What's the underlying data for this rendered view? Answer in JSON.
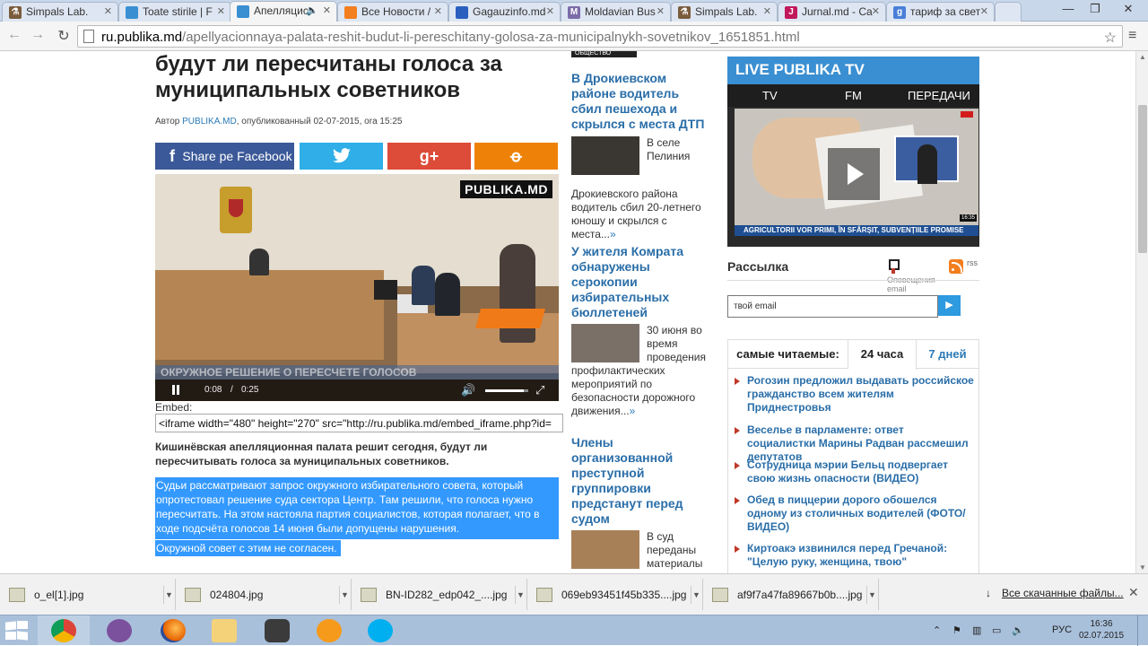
{
  "browser": {
    "tabs": [
      {
        "label": "Simpals Lab.",
        "icon": "flask-icon",
        "color": "#7a5c3c"
      },
      {
        "label": "Toate stirile | F",
        "icon": "page-icon",
        "color": "#3a8fd2"
      },
      {
        "label": "Апелляцис",
        "icon": "page-icon",
        "color": "#3a8fd2"
      },
      {
        "label": "Все Новости /",
        "icon": "rss-icon",
        "color": "#f27e1f"
      },
      {
        "label": "Gagauzinfo.md",
        "icon": "flag-icon",
        "color": "#2b5fbe"
      },
      {
        "label": "Moldavian Bus",
        "icon": "m-icon",
        "color": "#7b6ca8"
      },
      {
        "label": "Simpals Lab.",
        "icon": "flask-icon",
        "color": "#7a5c3c"
      },
      {
        "label": "Jurnal.md - Ca",
        "icon": "j-icon",
        "color": "#c2185b"
      },
      {
        "label": "тариф за свет",
        "icon": "google-icon",
        "color": "#4a7fd8"
      }
    ],
    "url_domain": "ru.publika.md",
    "url_path": "/apellyacionnaya-palata-reshit-budut-li-pereschitany-golosa-za-municipalnykh-sovetnikov_1651851.html"
  },
  "article": {
    "headline": "будут ли пересчитаны голоса за муниципальных советников",
    "byline_prefix": "Автор",
    "byline_author": "PUBLIKA.MD",
    "byline_suffix": ", опубликованный 02-07-2015, ora 15:25",
    "share": {
      "facebook": "Share pe Facebook",
      "twitter": "twitter",
      "google": "g+",
      "ok": "ok"
    },
    "video": {
      "logo": "PUBLIKA.MD",
      "lower_third": "ОКРУЖНОЕ РЕШЕНИЕ О ПЕРЕСЧЕТЕ ГОЛОСОВ",
      "time_current": "0:08",
      "time_sep": "/",
      "time_total": "0:25",
      "volume": 0.9
    },
    "embed_label": "Embed:",
    "embed_code": "<iframe width=\"480\" height=\"270\" src=\"http://ru.publika.md/embed_iframe.php?id=",
    "lead": "Кишинёвская апелляционная палата решит сегодня, будут ли пересчитывать голоса за муниципальных советников.",
    "p1": "Судьи рассматривают запрос окружного избирательного совета, который опротестовал решение суда сектора Центр. Там решили, что голоса нужно пересчитать. На этом настояла партия социалистов, которая полагает, что в ходе подсчёта голосов 14 июня были допущены нарушения.",
    "p2": "Окружной совет с этим не согласен."
  },
  "middle": {
    "rubric": "ОБЩЕСТВО",
    "items": [
      {
        "title": "В Дрокиевском районе водитель сбил пешехода и скрылся с места ДТП",
        "text_side": "В селе Пелиния",
        "text_full": "Дрокиевского района водитель сбил 20-летнего юношу и скрылся с места...",
        "more": "»"
      },
      {
        "title": "У жителя Комрата обнаружены серокопии избирательных бюллетеней",
        "text_side": "30 июня во время проведения",
        "text_full": "профилактических мероприятий по безопасности дорожного движения...",
        "more": "»"
      },
      {
        "title": "Члены организованной преступной группировки предстанут перед судом",
        "text_side": "В суд переданы материалы"
      }
    ]
  },
  "sidebar": {
    "live_title": "LIVE PUBLIKA TV",
    "live_tabs": [
      "TV",
      "FM",
      "ПЕРЕДАЧИ"
    ],
    "live_ticker": "AGRICULTORII VOR PRIMI, ÎN SFÂRȘIT, SUBVENȚIILE PROMISE",
    "live_clock": "16:35",
    "subscribe_title": "Рассылка",
    "notify_label": "Оповещения email",
    "rss_label": "rss",
    "email_placeholder": "твой email",
    "popular_title": "самые читаемые:",
    "popular_tabs": [
      "24 часа",
      "7 дней"
    ],
    "popular": [
      "Рогозин предложил выдавать российское гражданство всем жителям Приднестровья",
      "Веселье в парламенте: ответ социалистки Марины Радван рассмешил депутатов",
      "Сотрудница мэрии Бельц подвергает свою жизнь опасности (ВИДЕО)",
      "Обед в пиццерии дорого обошелся одному из столичных водителей (ФОТО/ ВИДЕО)",
      "Киртоакэ извинился перед Гречаной: \"Целую руку, женщина, твою\""
    ]
  },
  "downloads": {
    "files": [
      "o_el[1].jpg",
      "024804.jpg",
      "BN-ID282_edp042_....jpg",
      "069eb93451f45b335....jpg",
      "af9f7a47fa89667b0b....jpg"
    ],
    "show_all": "Все скачанные файлы..."
  },
  "taskbar": {
    "apps": [
      "chrome-icon",
      "viber-icon",
      "firefox-icon",
      "explorer-icon",
      "camera-icon",
      "chat-icon",
      "skype-icon"
    ],
    "lang": "РУС",
    "time": "16:36",
    "date": "02.07.2015"
  }
}
